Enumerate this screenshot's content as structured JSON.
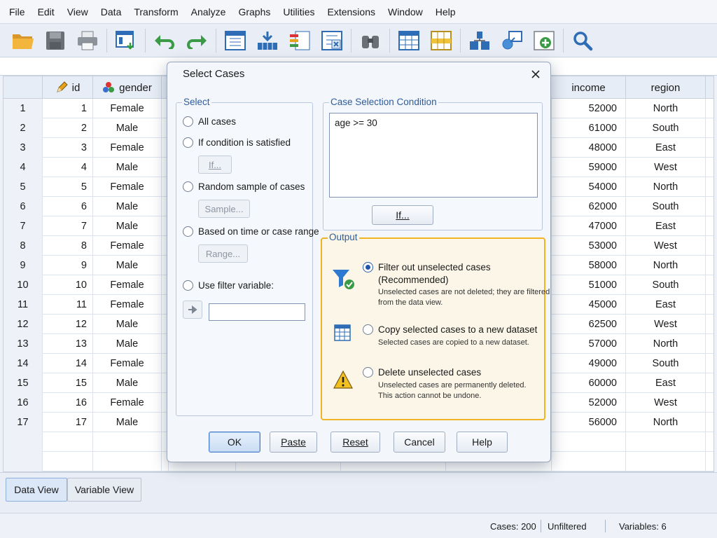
{
  "menu": [
    "File",
    "Edit",
    "View",
    "Data",
    "Transform",
    "Analyze",
    "Graphs",
    "Utilities",
    "Extensions",
    "Window",
    "Help"
  ],
  "toolbar_icons": [
    "open-folder-icon",
    "save-icon",
    "print-icon",
    "dialog-recall-icon",
    "undo-icon",
    "redo-icon",
    "goto-case-icon",
    "goto-variable-icon",
    "variables-icon",
    "run-descriptives-icon",
    "find-icon",
    "insert-cases-icon",
    "insert-variable-icon",
    "split-file-icon",
    "weight-cases-icon",
    "select-cases-icon",
    "value-labels-icon",
    "search-icon"
  ],
  "grid": {
    "columns": [
      {
        "key": "rownum",
        "label": ""
      },
      {
        "key": "id",
        "label": "id",
        "icon": "pencil-icon"
      },
      {
        "key": "gender",
        "label": "gender",
        "icon": "nominal-icon"
      },
      {
        "key": "income",
        "label": "income"
      },
      {
        "key": "region",
        "label": "region"
      }
    ],
    "rows": [
      {
        "n": "1",
        "id": "1",
        "gender": "Female",
        "income": "52000",
        "region": "North"
      },
      {
        "n": "2",
        "id": "2",
        "gender": "Male",
        "income": "61000",
        "region": "South"
      },
      {
        "n": "3",
        "id": "3",
        "gender": "Female",
        "income": "48000",
        "region": "East"
      },
      {
        "n": "4",
        "id": "4",
        "gender": "Male",
        "income": "59000",
        "region": "West"
      },
      {
        "n": "5",
        "id": "5",
        "gender": "Female",
        "income": "54000",
        "region": "North"
      },
      {
        "n": "6",
        "id": "6",
        "gender": "Male",
        "income": "62000",
        "region": "South"
      },
      {
        "n": "7",
        "id": "7",
        "gender": "Male",
        "income": "47000",
        "region": "East"
      },
      {
        "n": "8",
        "id": "8",
        "gender": "Female",
        "income": "53000",
        "region": "West"
      },
      {
        "n": "9",
        "id": "9",
        "gender": "Male",
        "income": "58000",
        "region": "North"
      },
      {
        "n": "10",
        "id": "10",
        "gender": "Female",
        "income": "51000",
        "region": "South"
      },
      {
        "n": "11",
        "id": "11",
        "gender": "Female",
        "income": "45000",
        "region": "East"
      },
      {
        "n": "12",
        "id": "12",
        "gender": "Male",
        "income": "62500",
        "region": "West"
      },
      {
        "n": "13",
        "id": "13",
        "gender": "Male",
        "income": "57000",
        "region": "North"
      },
      {
        "n": "14",
        "id": "14",
        "gender": "Female",
        "income": "49000",
        "region": "South"
      },
      {
        "n": "15",
        "id": "15",
        "gender": "Male",
        "income": "60000",
        "region": "East"
      },
      {
        "n": "16",
        "id": "16",
        "gender": "Female",
        "income": "52000",
        "region": "West"
      },
      {
        "n": "17",
        "id": "17",
        "gender": "Male",
        "income": "56000",
        "region": "North"
      }
    ]
  },
  "tabs": {
    "data_view": "Data View",
    "variable_view": "Variable View"
  },
  "status": {
    "cases": "Cases: 200",
    "filter": "Unfiltered",
    "variables": "Variables: 6"
  },
  "dialog": {
    "title": "Select Cases",
    "select_group": "Select",
    "options": {
      "all": "All cases",
      "if_condition": "If condition is satisfied",
      "random": "Random sample of cases",
      "time_range": "Based on time or case range",
      "filter_var": "Use filter variable:"
    },
    "sub_buttons": {
      "if": "If...",
      "sample": "Sample...",
      "range": "Range..."
    },
    "condition_group": "Case Selection Condition",
    "condition_text": "age >= 30",
    "condition_if_button": "If...",
    "output_group": "Output",
    "output": {
      "filter_label": "Filter out unselected cases",
      "filter_sub": "(Recommended)",
      "filter_desc_1": "Unselected cases are not deleted; they are filtered",
      "filter_desc_2": "from the data view.",
      "copy_label": "Copy selected cases to a new dataset",
      "copy_desc": "Selected cases are copied to a new dataset.",
      "delete_label": "Delete unselected cases",
      "delete_desc_1": "Unselected cases are permanently deleted.",
      "delete_desc_2": "This action cannot be undone."
    },
    "buttons": {
      "ok": "OK",
      "paste": "Paste",
      "reset": "Reset",
      "cancel": "Cancel",
      "help": "Help"
    }
  },
  "colors": {
    "accent": "#1f56a8",
    "output_highlight": "#f0b323",
    "group_title": "#2e5c9a"
  }
}
